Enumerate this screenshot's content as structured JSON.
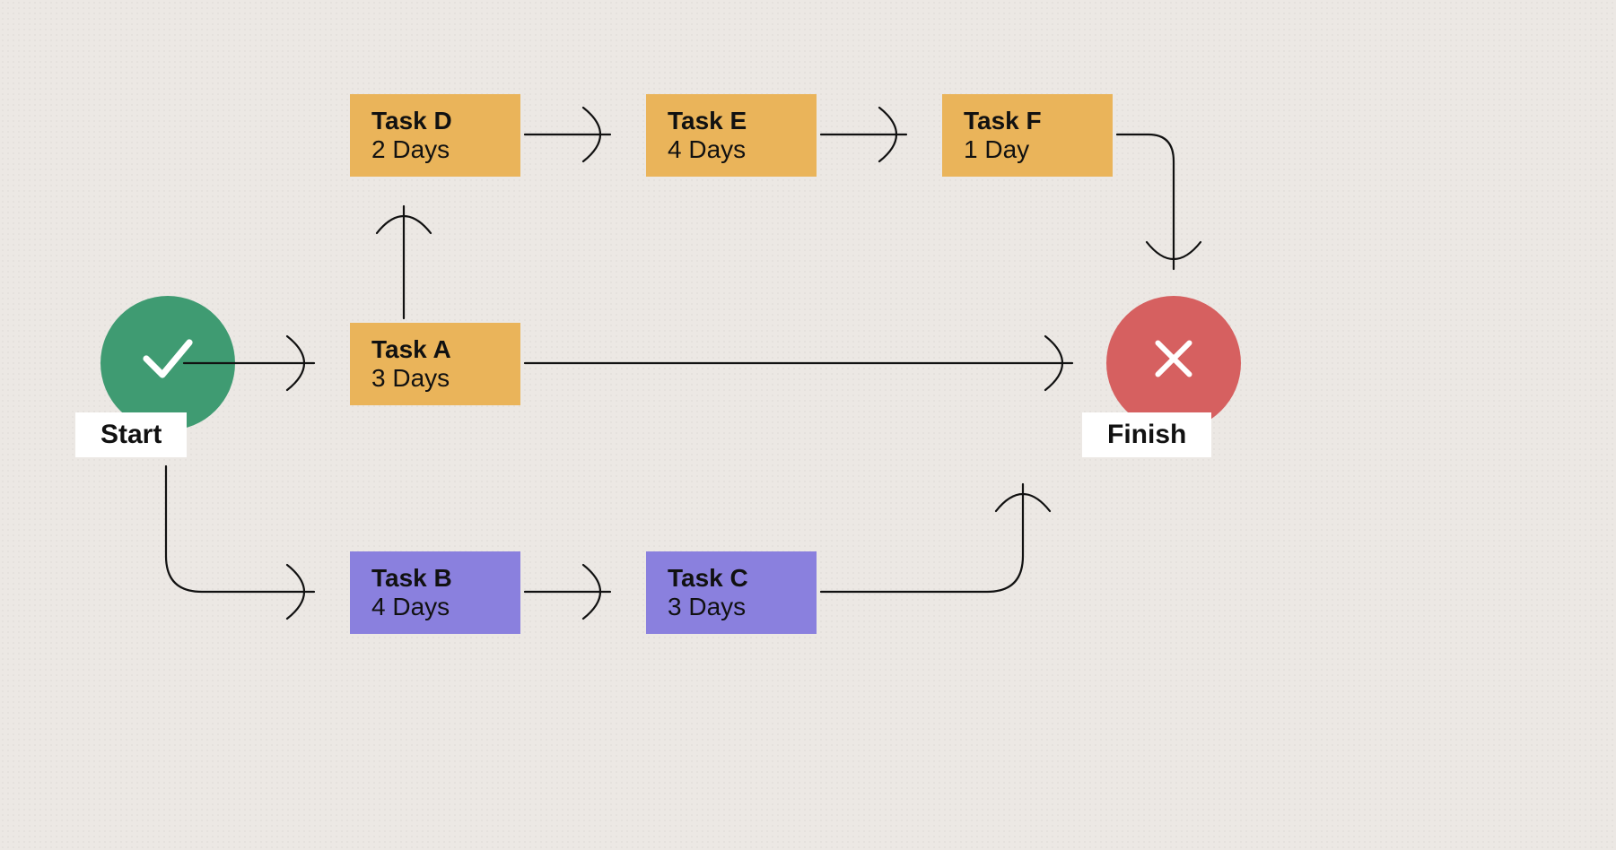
{
  "start": {
    "label": "Start"
  },
  "finish": {
    "label": "Finish"
  },
  "tasks": {
    "a": {
      "title": "Task A",
      "days": "3 Days"
    },
    "b": {
      "title": "Task B",
      "days": "4 Days"
    },
    "c": {
      "title": "Task C",
      "days": "3 Days"
    },
    "d": {
      "title": "Task D",
      "days": "2 Days"
    },
    "e": {
      "title": "Task E",
      "days": "4 Days"
    },
    "f": {
      "title": "Task F",
      "days": "1 Day"
    }
  },
  "colors": {
    "start": "#3f9b72",
    "finish": "#d66060",
    "orange": "#eab45a",
    "purple": "#8a80de",
    "bg": "#ece8e4"
  },
  "flow": {
    "edges": [
      [
        "Start",
        "Task A"
      ],
      [
        "Start",
        "Task B"
      ],
      [
        "Task A",
        "Task D"
      ],
      [
        "Task A",
        "Finish"
      ],
      [
        "Task D",
        "Task E"
      ],
      [
        "Task E",
        "Task F"
      ],
      [
        "Task F",
        "Finish"
      ],
      [
        "Task B",
        "Task C"
      ],
      [
        "Task C",
        "Finish"
      ]
    ]
  }
}
